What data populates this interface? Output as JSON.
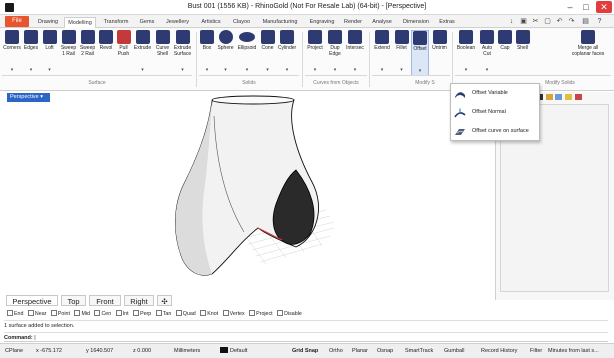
{
  "window": {
    "title": "Bust 001 (1556 KB) - RhinoGold (Not For Resale Lab) (64-bit) - [Perspective]",
    "controls": [
      "–",
      "□",
      "✕"
    ]
  },
  "ribbon_tabs": {
    "file": "File",
    "tabs": [
      "Drawing",
      "Modelling",
      "Transform",
      "Gems",
      "Jewellery",
      "Artistics",
      "Clayoo",
      "Manufacturing",
      "Engraving",
      "Render",
      "Analyse",
      "Dimension",
      "Extras"
    ],
    "active": "Modelling"
  },
  "quick_access": [
    "↓",
    "▣",
    "✂",
    "▢",
    "↶",
    "↷",
    "▤",
    "?"
  ],
  "toolbar": {
    "tools": [
      {
        "label": "Corners",
        "icon": "corners-icon"
      },
      {
        "label": "Edges",
        "icon": "edges-icon"
      },
      {
        "label": "Loft",
        "icon": "loft-icon"
      },
      {
        "label": "Sweep\n1 Rail",
        "icon": "sweep1-icon"
      },
      {
        "label": "Sweep\n2 Rail",
        "icon": "sweep2-icon"
      },
      {
        "label": "Revol",
        "icon": "revolve-icon"
      },
      {
        "label": "Pull\nPush",
        "icon": "pullpush-icon"
      },
      {
        "label": "Extrude",
        "icon": "extrude-icon"
      },
      {
        "label": "Curve\nShell",
        "icon": "curveshell-icon"
      },
      {
        "label": "Extrude\nSurface",
        "icon": "extrudesurface-icon"
      },
      {
        "label": "Box",
        "icon": "box-icon"
      },
      {
        "label": "Sphere",
        "icon": "sphere-icon"
      },
      {
        "label": "Ellipsoid",
        "icon": "ellipsoid-icon"
      },
      {
        "label": "Cone",
        "icon": "cone-icon"
      },
      {
        "label": "Cylinder",
        "icon": "cylinder-icon"
      },
      {
        "label": "Project",
        "icon": "project-icon"
      },
      {
        "label": "Dup\nEdge",
        "icon": "dupedge-icon"
      },
      {
        "label": "Intersec",
        "icon": "intersect-icon"
      },
      {
        "label": "Extend",
        "icon": "extend-icon"
      },
      {
        "label": "Fillet",
        "icon": "fillet-icon"
      },
      {
        "label": "Offset",
        "icon": "offset-icon"
      },
      {
        "label": "Untrim",
        "icon": "untrim-icon"
      },
      {
        "label": "Boolean",
        "icon": "boolean-icon"
      },
      {
        "label": "Auto\nCut",
        "icon": "autocut-icon"
      },
      {
        "label": "Cap",
        "icon": "cap-icon"
      },
      {
        "label": "Shell",
        "icon": "shell-icon"
      },
      {
        "label": "Merge all\ncoplanar faces",
        "icon": "mergefaces-icon"
      }
    ],
    "groups": [
      "Surface",
      "Solids",
      "Curves from Objects",
      "Modify S",
      "Modify Solids"
    ]
  },
  "offset_menu": {
    "items": [
      {
        "label": "Offset Variable",
        "icon": "offset-variable-icon"
      },
      {
        "label": "Offset Normal",
        "icon": "offset-normal-icon"
      },
      {
        "label": "Offset curve on surface",
        "icon": "offset-curve-on-surface-icon"
      }
    ]
  },
  "viewport": {
    "name": "Perspective",
    "menu_arrow": "▾"
  },
  "viewport_tabs": {
    "tabs": [
      "Perspective",
      "Top",
      "Front",
      "Right"
    ],
    "add": "✣"
  },
  "osnaps": [
    "End",
    "Near",
    "Point",
    "Mid",
    "Cen",
    "Int",
    "Perp",
    "Tan",
    "Quad",
    "Knot",
    "Vertex",
    "Project",
    "Disable"
  ],
  "history": "1 surface added to selection.",
  "command": {
    "label": "Command:"
  },
  "status": {
    "cplane": "CPlane",
    "x": "x -675.172",
    "y": "y 1640.507",
    "z": "z 0.000",
    "units": "Millimeters",
    "layer": "Default",
    "layer_color": "#111111",
    "toggles": [
      "Grid Snap",
      "Ortho",
      "Planar",
      "Osnap",
      "SmartTrack",
      "Gumball",
      "Record History",
      "Filter"
    ],
    "bold_toggle": "Grid Snap",
    "message": "Minutes from last s..."
  },
  "colors": {
    "file_tab": "#e8542e",
    "viewport_header": "#2b66c6",
    "tool_icon": "#2d3b72"
  }
}
